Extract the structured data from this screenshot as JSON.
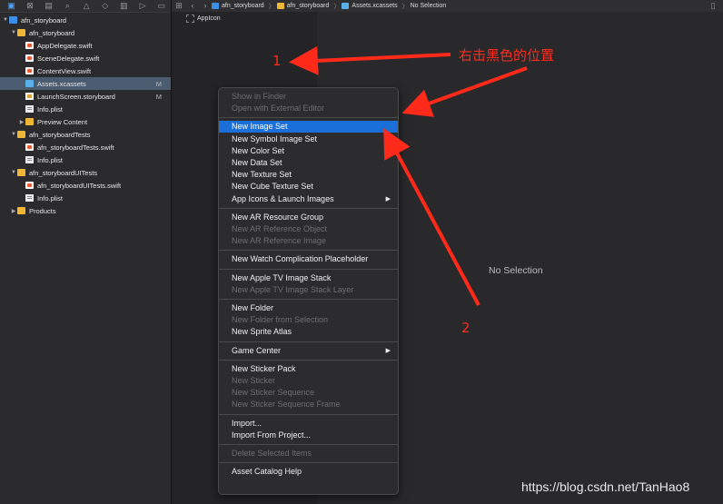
{
  "breadcrumb": {
    "items": [
      "afn_storyboard",
      "afn_storyboard",
      "Assets.xcassets",
      "No Selection"
    ]
  },
  "navigator": {
    "items": [
      {
        "label": "afn_storyboard",
        "icon": "project-icon",
        "indent": 0,
        "disclosure": "▼",
        "badge": ""
      },
      {
        "label": "afn_storyboard",
        "icon": "folder-icon",
        "indent": 1,
        "disclosure": "▼",
        "badge": ""
      },
      {
        "label": "AppDelegate.swift",
        "icon": "swift-file-icon",
        "indent": 2,
        "disclosure": "",
        "badge": ""
      },
      {
        "label": "SceneDelegate.swift",
        "icon": "swift-file-icon",
        "indent": 2,
        "disclosure": "",
        "badge": ""
      },
      {
        "label": "ContentView.swift",
        "icon": "swift-file-icon",
        "indent": 2,
        "disclosure": "",
        "badge": ""
      },
      {
        "label": "Assets.xcassets",
        "icon": "asset-catalog-icon",
        "indent": 2,
        "disclosure": "",
        "badge": "M",
        "selected": true
      },
      {
        "label": "LaunchScreen.storyboard",
        "icon": "storyboard-icon",
        "indent": 2,
        "disclosure": "",
        "badge": "M"
      },
      {
        "label": "Info.plist",
        "icon": "plist-icon",
        "indent": 2,
        "disclosure": "",
        "badge": ""
      },
      {
        "label": "Preview Content",
        "icon": "folder-icon",
        "indent": 2,
        "disclosure": "▶",
        "badge": ""
      },
      {
        "label": "afn_storyboardTests",
        "icon": "folder-icon",
        "indent": 1,
        "disclosure": "▼",
        "badge": ""
      },
      {
        "label": "afn_storyboardTests.swift",
        "icon": "swift-file-icon",
        "indent": 2,
        "disclosure": "",
        "badge": ""
      },
      {
        "label": "Info.plist",
        "icon": "plist-icon",
        "indent": 2,
        "disclosure": "",
        "badge": ""
      },
      {
        "label": "afn_storyboardUITests",
        "icon": "folder-icon",
        "indent": 1,
        "disclosure": "▼",
        "badge": ""
      },
      {
        "label": "afn_storyboardUITests.swift",
        "icon": "swift-file-icon",
        "indent": 2,
        "disclosure": "",
        "badge": ""
      },
      {
        "label": "Info.plist",
        "icon": "plist-icon",
        "indent": 2,
        "disclosure": "",
        "badge": ""
      },
      {
        "label": "Products",
        "icon": "folder-icon",
        "indent": 1,
        "disclosure": "▶",
        "badge": ""
      }
    ]
  },
  "assets": {
    "appicon_label": "AppIcon"
  },
  "editor": {
    "no_selection": "No Selection"
  },
  "context_menu": {
    "groups": [
      [
        {
          "label": "Show in Finder",
          "disabled": true
        },
        {
          "label": "Open with External Editor",
          "disabled": true
        }
      ],
      [
        {
          "label": "New Image Set",
          "highlighted": true
        },
        {
          "label": "New Symbol Image Set"
        },
        {
          "label": "New Color Set"
        },
        {
          "label": "New Data Set"
        },
        {
          "label": "New Texture Set"
        },
        {
          "label": "New Cube Texture Set"
        },
        {
          "label": "App Icons & Launch Images",
          "submenu": true
        }
      ],
      [
        {
          "label": "New AR Resource Group"
        },
        {
          "label": "New AR Reference Object",
          "disabled": true
        },
        {
          "label": "New AR Reference Image",
          "disabled": true
        }
      ],
      [
        {
          "label": "New Watch Complication Placeholder"
        }
      ],
      [
        {
          "label": "New Apple TV Image Stack"
        },
        {
          "label": "New Apple TV Image Stack Layer",
          "disabled": true
        }
      ],
      [
        {
          "label": "New Folder"
        },
        {
          "label": "New Folder from Selection",
          "disabled": true
        },
        {
          "label": "New Sprite Atlas"
        }
      ],
      [
        {
          "label": "Game Center",
          "submenu": true
        }
      ],
      [
        {
          "label": "New Sticker Pack"
        },
        {
          "label": "New Sticker",
          "disabled": true
        },
        {
          "label": "New Sticker Sequence",
          "disabled": true
        },
        {
          "label": "New Sticker Sequence Frame",
          "disabled": true
        }
      ],
      [
        {
          "label": "Import..."
        },
        {
          "label": "Import From Project..."
        }
      ],
      [
        {
          "label": "Delete Selected Items",
          "disabled": true
        }
      ],
      [
        {
          "label": "Asset Catalog Help"
        }
      ]
    ]
  },
  "annotations": {
    "label_1": "1",
    "label_2": "2",
    "chinese_note": "右击黑色的位置",
    "arrow_color": "#ff2a1a"
  },
  "watermark": "https://blog.csdn.net/TanHao8",
  "colors": {
    "highlight": "#1a6fd8",
    "selection": "#4b5c71",
    "annotation": "#ff2a1a"
  }
}
